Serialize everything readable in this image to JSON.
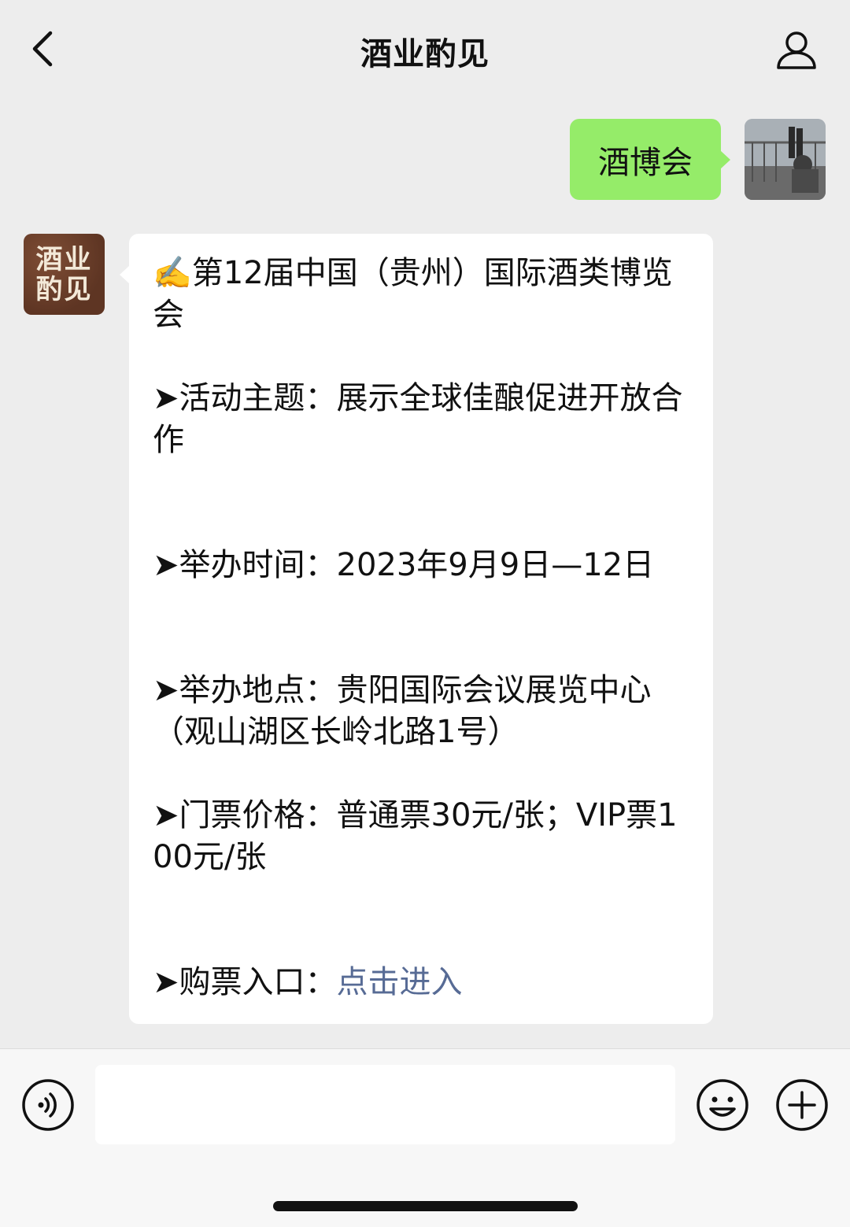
{
  "header": {
    "title": "酒业酌见",
    "back_icon": "chevron-left-icon",
    "profile_icon": "person-icon"
  },
  "messages": {
    "user": {
      "text": "酒博会",
      "bubble_color": "#95ec69"
    },
    "bot": {
      "avatar_text_line1": "酒业",
      "avatar_text_line2": "酌见",
      "lines": {
        "title": "✍️第12届中国（贵州）国际酒类博览会",
        "theme": "➤活动主题：展示全球佳酿促进开放合作",
        "time": "➤举办时间：2023年9月9日—12日",
        "location": "➤举办地点：贵阳国际会议展览中心（观山湖区长岭北路1号）",
        "price": " ➤门票价格：普通票30元/张；VIP票100元/张",
        "ticket_prefix": "➤购票入口：",
        "ticket_link": "点击进入"
      },
      "link_color": "#576b95"
    }
  },
  "input_bar": {
    "voice_icon": "voice-icon",
    "emoji_icon": "emoji-icon",
    "plus_icon": "plus-icon",
    "input_value": ""
  }
}
